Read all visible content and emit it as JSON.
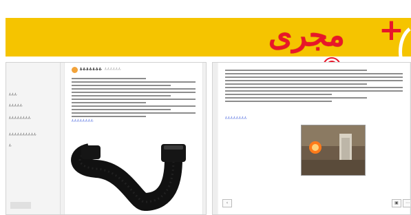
{
  "header": {
    "brand": "مجری",
    "plus": "+",
    "accent_color": "#f5c400",
    "brand_color": "#e8162a"
  },
  "left_pane": {
    "sidebar_items": [
      "Â·Â·Â·",
      "Â·Â·Â·Â·Â·",
      "Â·Â·Â·Â·Â·Â·Â·Â·",
      "Â·Â·Â·Â·Â·Â·Â·Â·Â·Â·",
      "Â·"
    ],
    "post": {
      "user": "Â·Â·Â·Â·Â·Â·Â·",
      "meta": "Â·Â·Â·Â·Â·Â·",
      "link": "Â·Â·Â·Â·Â·Â·Â·Â·"
    },
    "image_subject": "black-p-trap-pipe"
  },
  "right_pane": {
    "link": "Â·Â·Â·Â·Â·Â·Â·Â·",
    "photo_subject": "construction-plumbing-photo",
    "icons": [
      "share-icon",
      "save-icon",
      "more-icon"
    ]
  }
}
